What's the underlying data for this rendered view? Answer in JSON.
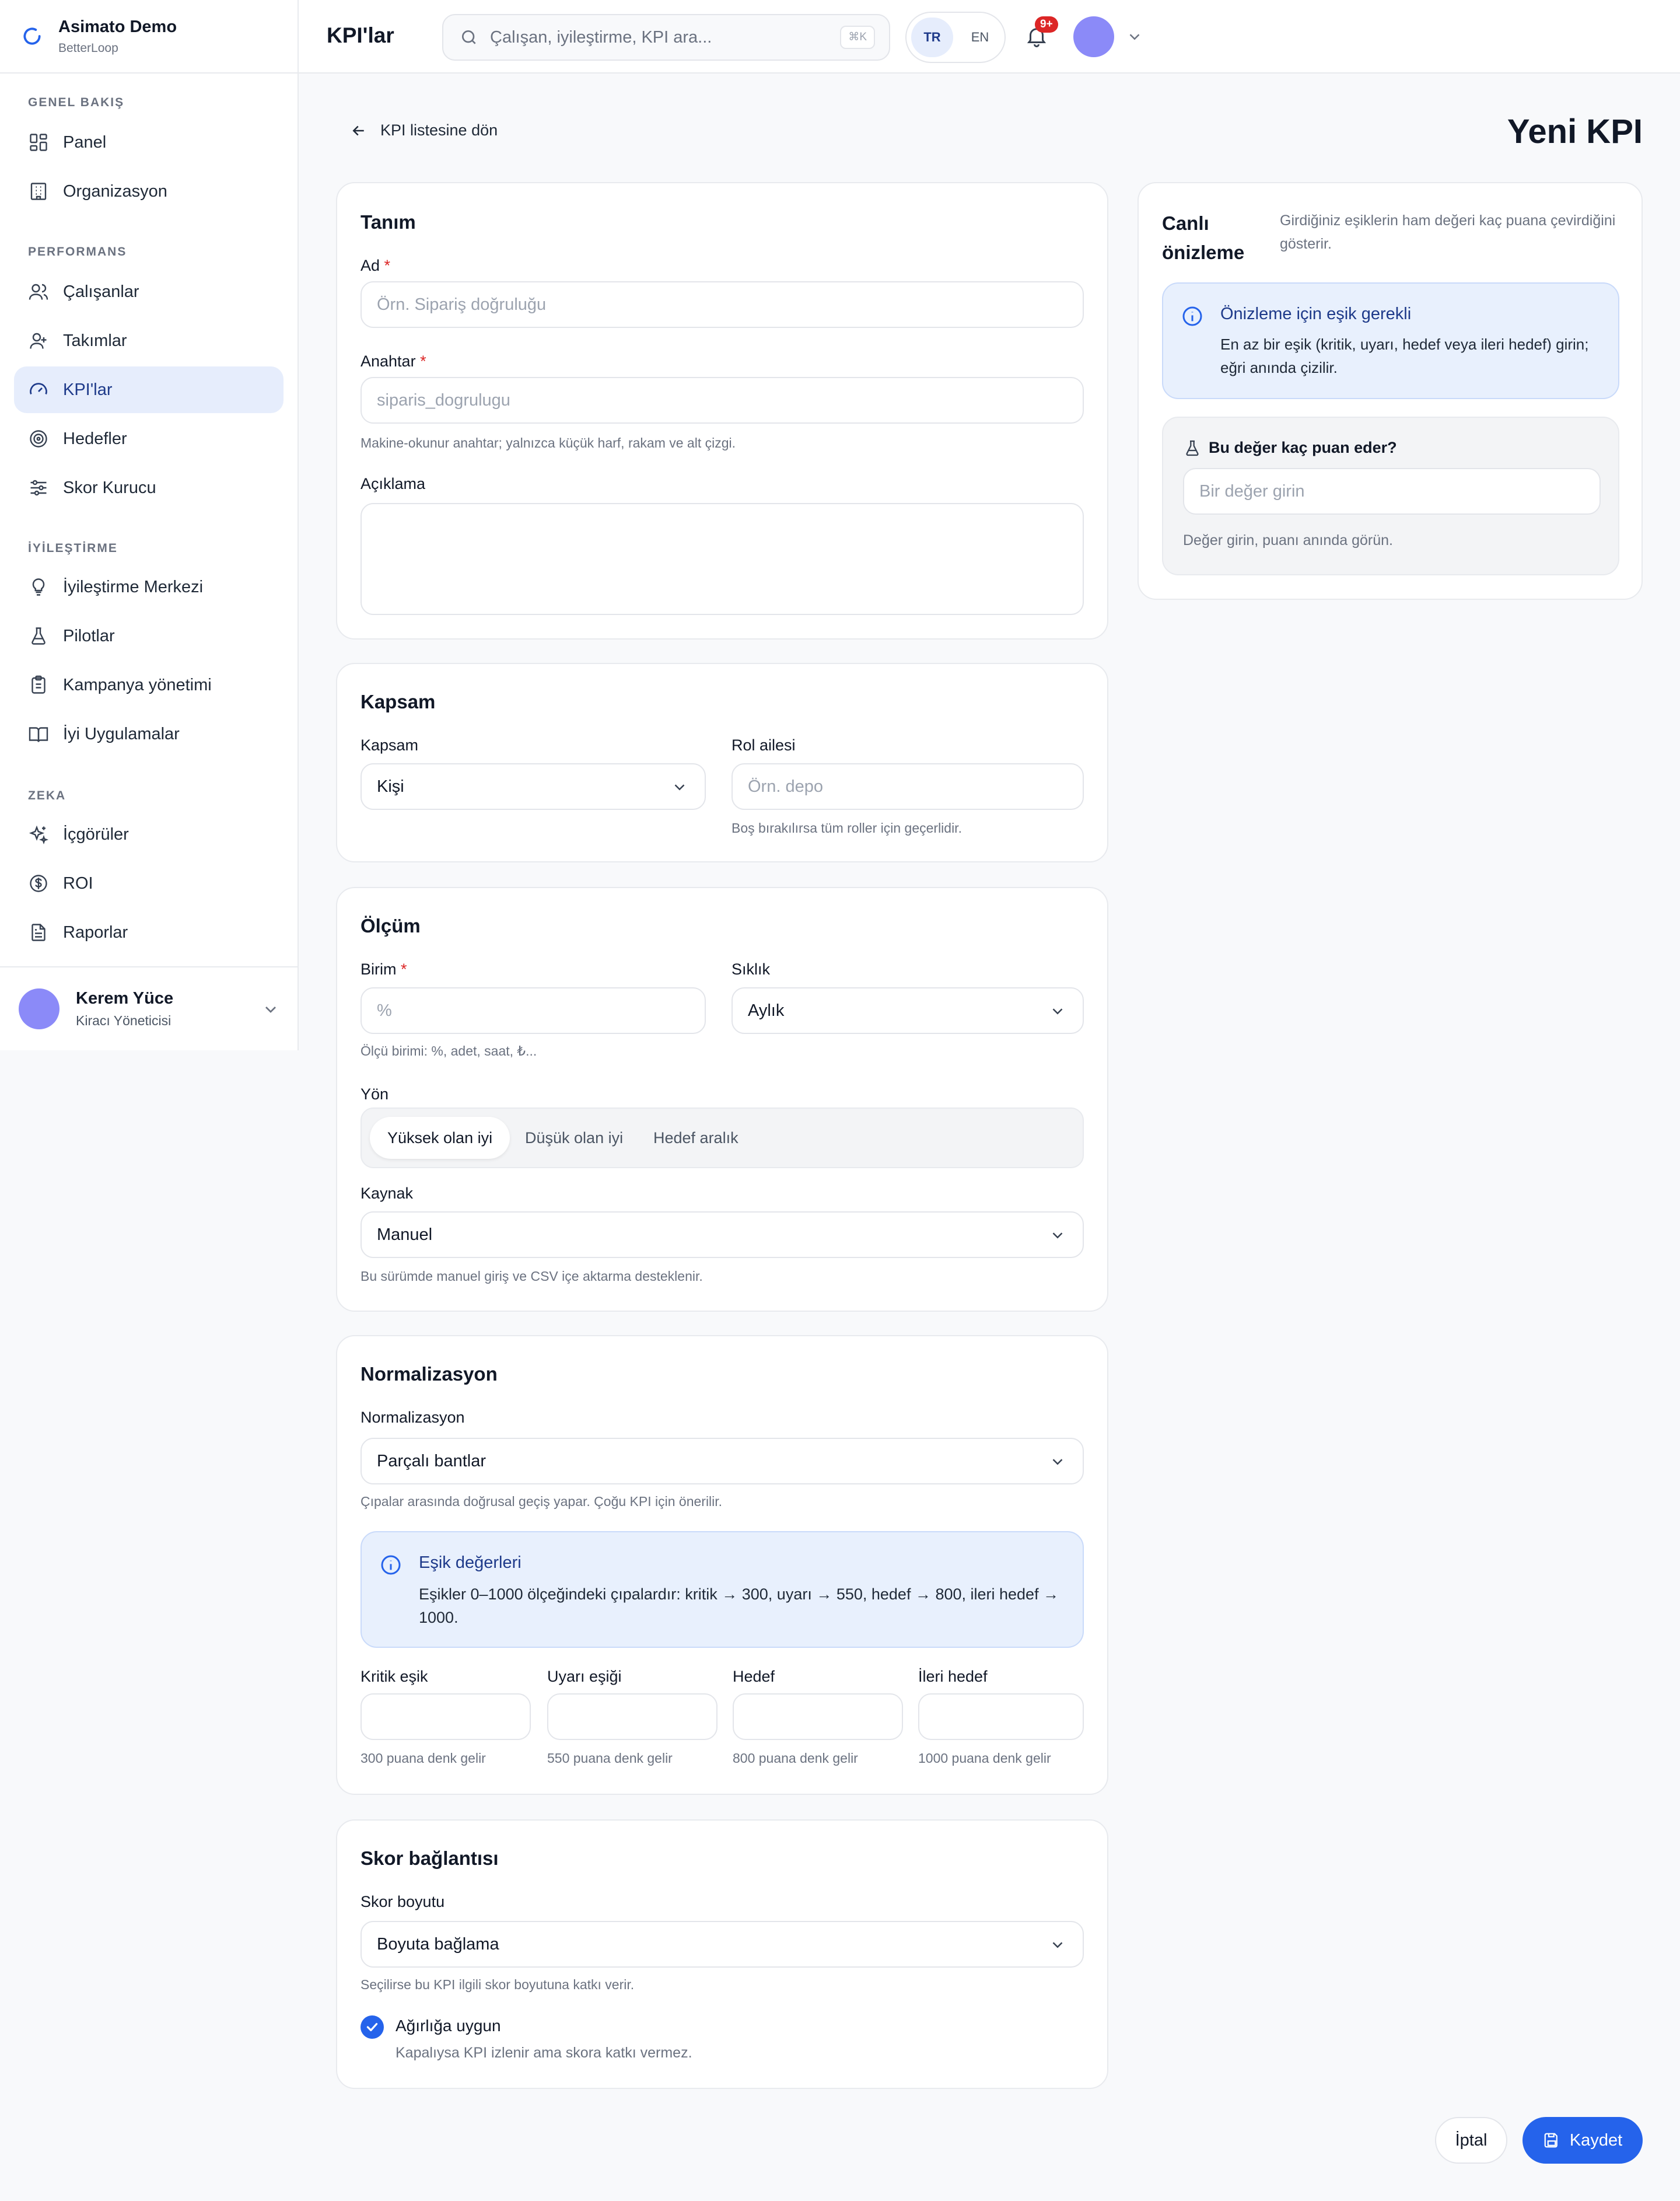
{
  "brand": {
    "title": "Asimato Demo",
    "subtitle": "BetterLoop"
  },
  "nav": {
    "sections": {
      "overview": "GENEL BAKIŞ",
      "performance": "PERFORMANS",
      "improvement": "İYİLEŞTİRME",
      "intelligence": "ZEKA"
    },
    "items": [
      {
        "label": "Panel",
        "icon": "dashboard-icon"
      },
      {
        "label": "Organizasyon",
        "icon": "building-icon"
      },
      {
        "label": "Çalışanlar",
        "icon": "users-icon"
      },
      {
        "label": "Takımlar",
        "icon": "team-icon"
      },
      {
        "label": "KPI'lar",
        "icon": "gauge-icon",
        "active": true
      },
      {
        "label": "Hedefler",
        "icon": "target-icon"
      },
      {
        "label": "Skor Kurucu",
        "icon": "sliders-icon"
      },
      {
        "label": "İyileştirme Merkezi",
        "icon": "lightbulb-icon"
      },
      {
        "label": "Pilotlar",
        "icon": "flask-icon"
      },
      {
        "label": "Kampanya yönetimi",
        "icon": "clipboard-icon"
      },
      {
        "label": "İyi Uygulamalar",
        "icon": "book-icon"
      },
      {
        "label": "İçgörüler",
        "icon": "sparkles-icon"
      },
      {
        "label": "ROI",
        "icon": "dollar-icon"
      },
      {
        "label": "Raporlar",
        "icon": "file-text-icon"
      }
    ]
  },
  "user": {
    "name": "Kerem Yüce",
    "role": "Kiracı Yöneticisi"
  },
  "topbar": {
    "title": "KPI'lar",
    "search_placeholder": "Çalışan, iyileştirme, KPI ara...",
    "shortcut": "⌘K",
    "lang_active": "TR",
    "lang_other": "EN",
    "notifications": "9+"
  },
  "page": {
    "back": "KPI listesine dön",
    "title": "Yeni KPI"
  },
  "definition": {
    "title": "Tanım",
    "name_label": "Ad",
    "name_placeholder": "Örn. Sipariş doğruluğu",
    "key_label": "Anahtar",
    "key_placeholder": "siparis_dogrulugu",
    "key_help": "Makine-okunur anahtar; yalnızca küçük harf, rakam ve alt çizgi.",
    "desc_label": "Açıklama"
  },
  "scope": {
    "title": "Kapsam",
    "scope_label": "Kapsam",
    "scope_value": "Kişi",
    "role_label": "Rol ailesi",
    "role_placeholder": "Örn. depo",
    "role_help": "Boş bırakılırsa tüm roller için geçerlidir."
  },
  "measurement": {
    "title": "Ölçüm",
    "unit_label": "Birim",
    "unit_placeholder": "%",
    "unit_help": "Ölçü birimi: %, adet, saat, ₺...",
    "freq_label": "Sıklık",
    "freq_value": "Aylık",
    "direction_label": "Yön",
    "direction_options": [
      "Yüksek olan iyi",
      "Düşük olan iyi",
      "Hedef aralık"
    ],
    "direction_selected": "Yüksek olan iyi",
    "source_label": "Kaynak",
    "source_value": "Manuel",
    "source_help": "Bu sürümde manuel giriş ve CSV içe aktarma desteklenir."
  },
  "normalization": {
    "title": "Normalizasyon",
    "label": "Normalizasyon",
    "value": "Parçalı bantlar",
    "help": "Çıpalar arasında doğrusal geçiş yapar. Çoğu KPI için önerilir.",
    "info_title": "Eşik değerleri",
    "info_body": "Eşikler 0–1000 ölçeğindeki çıpalardır: kritik → 300, uyarı → 550, hedef → 800, ileri hedef → 1000.",
    "thresholds": [
      {
        "label": "Kritik eşik",
        "help": "300 puana denk gelir"
      },
      {
        "label": "Uyarı eşiği",
        "help": "550 puana denk gelir"
      },
      {
        "label": "Hedef",
        "help": "800 puana denk gelir"
      },
      {
        "label": "İleri hedef",
        "help": "1000 puana denk gelir"
      }
    ]
  },
  "score_link": {
    "title": "Skor bağlantısı",
    "dim_label": "Skor boyutu",
    "dim_value": "Boyuta bağlama",
    "dim_help": "Seçilirse bu KPI ilgili skor boyutuna katkı verir.",
    "weight_label": "Ağırlığa uygun",
    "weight_help": "Kapalıysa KPI izlenir ama skora katkı vermez.",
    "weight_checked": true
  },
  "preview": {
    "title": "Canlı önizleme",
    "desc": "Girdiğiniz eşiklerin ham değeri kaç puana çevirdiğini gösterir.",
    "info_title": "Önizleme için eşik gerekli",
    "info_body": "En az bir eşik (kritik, uyarı, hedef veya ileri hedef) girin; eğri anında çizilir.",
    "probe_label": "Bu değer kaç puan eder?",
    "probe_placeholder": "Bir değer girin",
    "probe_help": "Değer girin, puanı anında görün."
  },
  "actions": {
    "cancel": "İptal",
    "save": "Kaydet"
  },
  "colors": {
    "primary": "#2563eb",
    "active_nav_bg": "#e6edfc",
    "info_bg": "#e8f0fd",
    "danger": "#dc2626",
    "avatar": "#8b8af8"
  }
}
